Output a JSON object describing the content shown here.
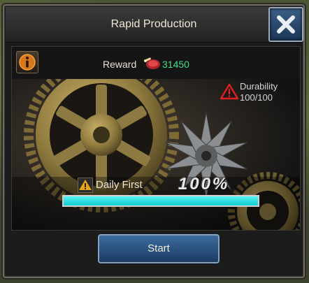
{
  "dialog": {
    "title": "Rapid Production"
  },
  "reward": {
    "label": "Reward",
    "icon": "meat-icon",
    "value": "31450"
  },
  "durability": {
    "label": "Durability",
    "value": "100/100",
    "icon": "warning-triangle-icon"
  },
  "daily_first": {
    "label": "Daily First",
    "icon": "warning-icon"
  },
  "progress": {
    "percent_text": "100%",
    "fraction": 1.0,
    "fill_color": "#22d9dc"
  },
  "buttons": {
    "start_label": "Start",
    "info_icon": "info-icon",
    "close_icon": "close-icon"
  },
  "colors": {
    "reward_value": "#3fe08a",
    "button_blue": "#2a5585",
    "durability_icon": "#e02020"
  }
}
